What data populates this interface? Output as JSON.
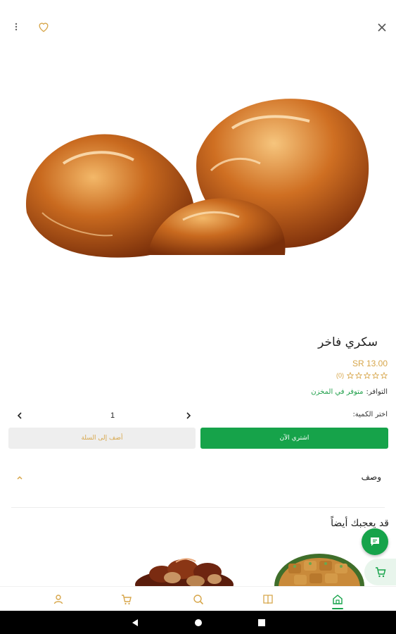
{
  "product": {
    "title": "سكري فاخر",
    "price": "SR 13.00",
    "rating_count": "(0)",
    "availability_label": "التوافر:",
    "availability_value": "متوفر في المخزن"
  },
  "quantity": {
    "label": "اختر الكمية:",
    "value": "1"
  },
  "actions": {
    "buy_now": "اشتري الآن",
    "add_to_cart": "أضف إلى السلة"
  },
  "sections": {
    "description": "وصف",
    "related": "قد يعجبك أيضاً"
  },
  "colors": {
    "accent_green": "#16a34a",
    "gold": "#d7a64a"
  },
  "icons": {
    "top_left": [
      "more-vert-icon",
      "heart-icon"
    ],
    "top_right": "close-icon",
    "bottom_nav": [
      "user-icon",
      "cart-icon",
      "search-icon",
      "book-icon",
      "home-icon"
    ],
    "fabs": [
      "chat-icon",
      "cart-fab-icon"
    ],
    "system": [
      "back-icon",
      "home-circle-icon",
      "recents-icon"
    ]
  }
}
